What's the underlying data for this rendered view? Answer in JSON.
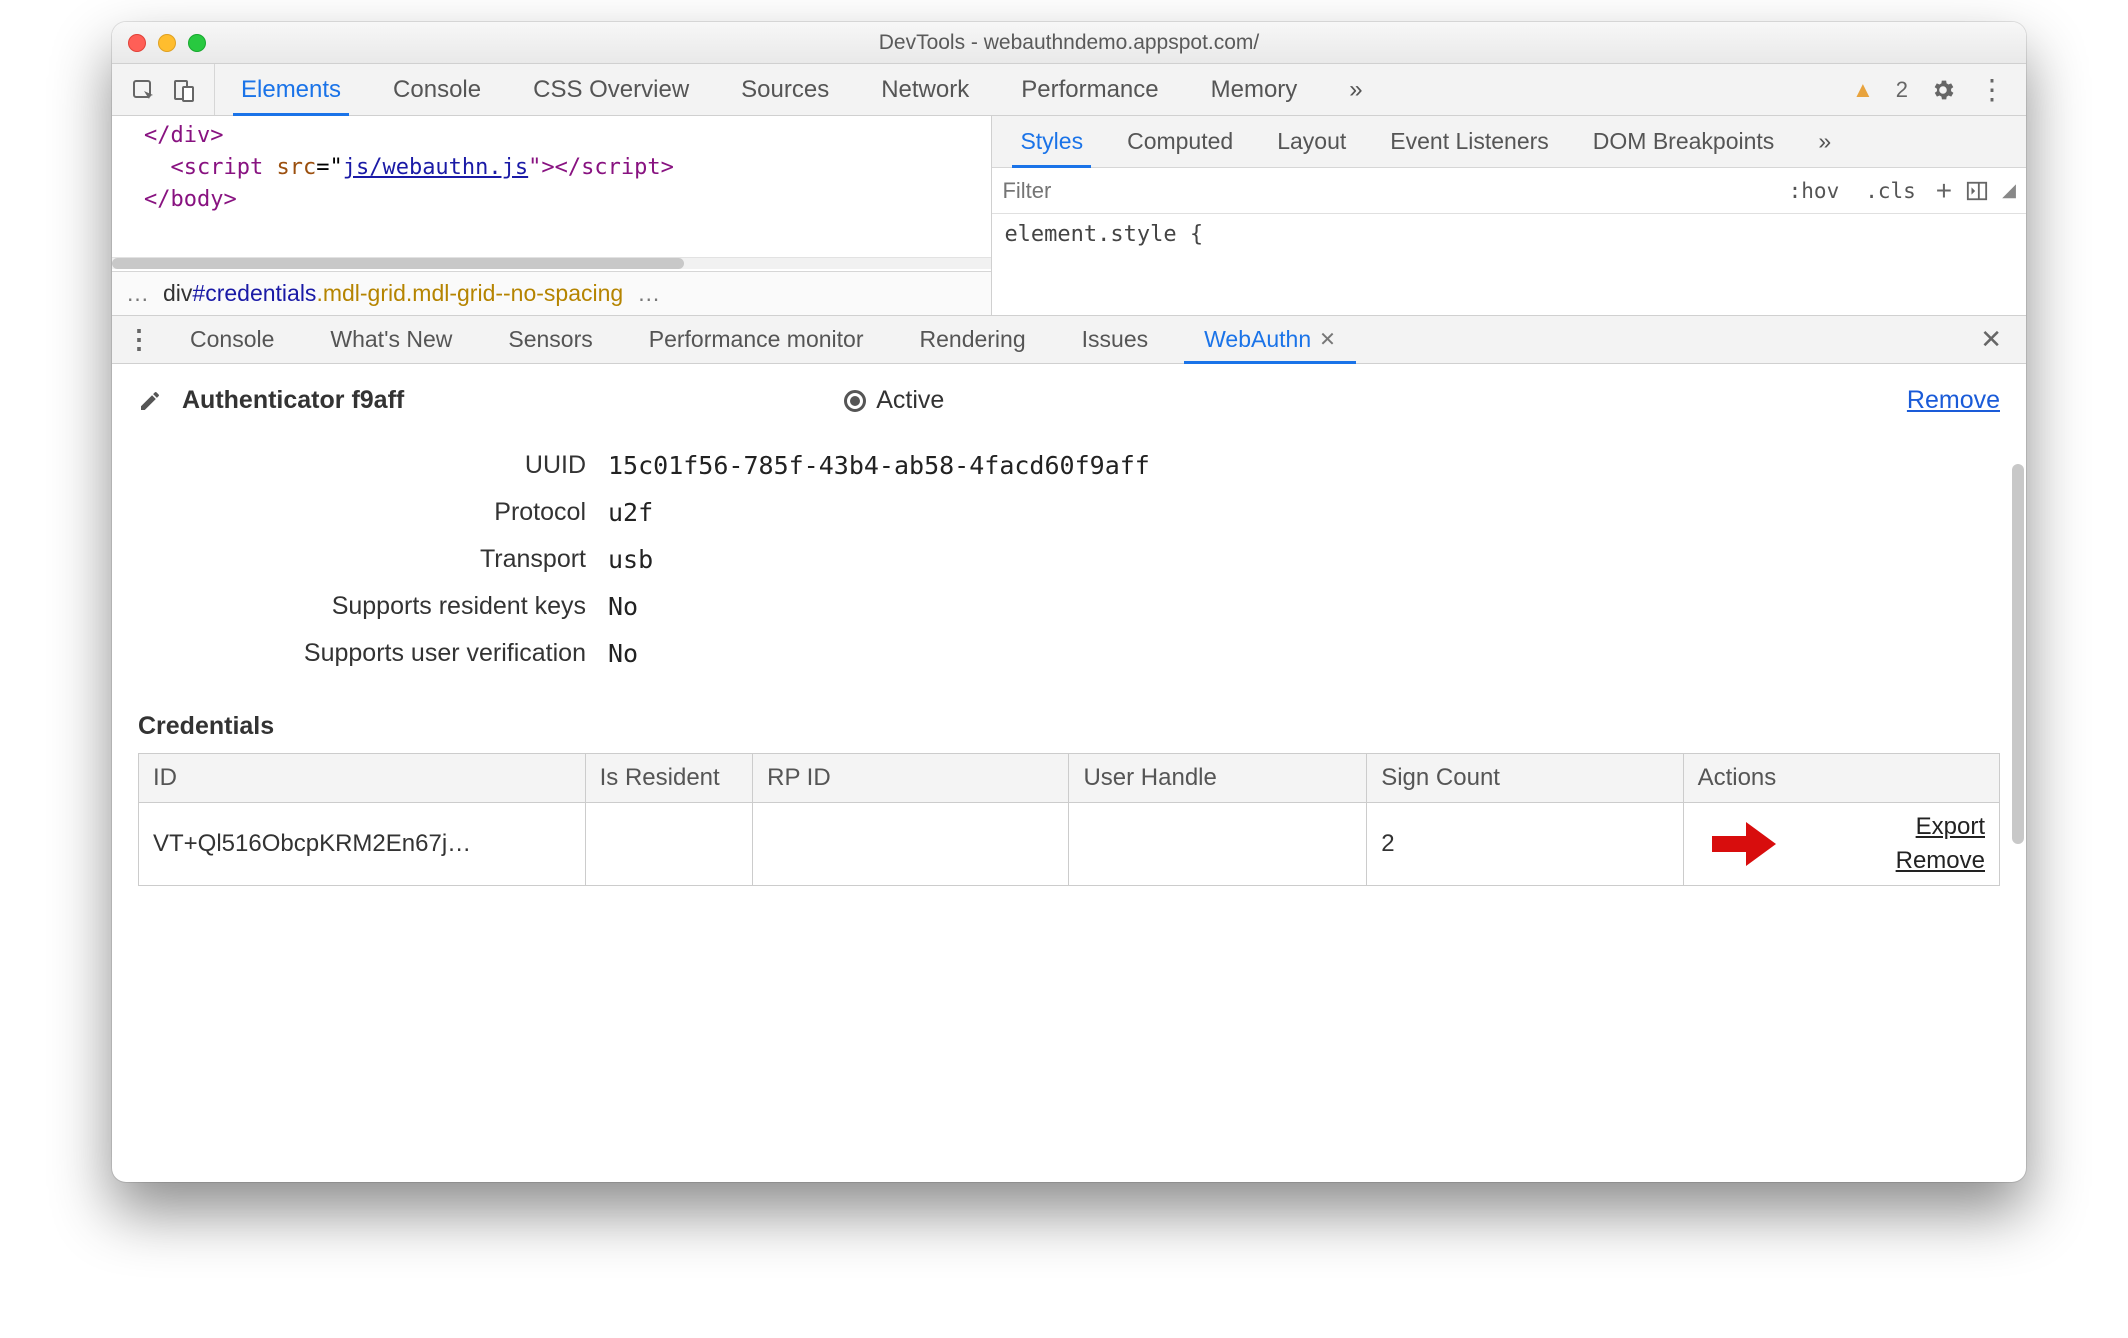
{
  "window": {
    "title": "DevTools - webauthndemo.appspot.com/"
  },
  "mainTabs": {
    "items": [
      "Elements",
      "Console",
      "CSS Overview",
      "Sources",
      "Network",
      "Performance",
      "Memory"
    ],
    "activeIndex": 0,
    "more": "»"
  },
  "warnings": {
    "count": "2"
  },
  "elementsCode": {
    "line1a": "</",
    "line1b": "div",
    "line1c": ">",
    "line2a": "<",
    "line2b": "script",
    "line2c": " src",
    "line2d": "=\"",
    "line2e": "js/webauthn.js",
    "line2f": "\"></",
    "line2g": "script",
    "line2h": ">",
    "line3a": "</",
    "line3b": "body",
    "line3c": ">"
  },
  "breadcrumb": {
    "pre": "…",
    "element": "div",
    "id": "#credentials",
    "classes": ".mdl-grid.mdl-grid--no-spacing",
    "post": "…"
  },
  "stylesTabs": {
    "items": [
      "Styles",
      "Computed",
      "Layout",
      "Event Listeners",
      "DOM Breakpoints"
    ],
    "activeIndex": 0,
    "more": "»"
  },
  "filter": {
    "placeholder": "Filter",
    "hov": ":hov",
    "cls": ".cls"
  },
  "styleBody": "element.style {",
  "drawerTabs": {
    "items": [
      "Console",
      "What's New",
      "Sensors",
      "Performance monitor",
      "Rendering",
      "Issues",
      "WebAuthn"
    ],
    "activeIndex": 6
  },
  "auth": {
    "name": "Authenticator f9aff",
    "active": "Active",
    "remove": "Remove",
    "uuidLabel": "UUID",
    "uuid": "15c01f56-785f-43b4-ab58-4facd60f9aff",
    "protocolLabel": "Protocol",
    "protocol": "u2f",
    "transportLabel": "Transport",
    "transport": "usb",
    "residentLabel": "Supports resident keys",
    "resident": "No",
    "verifyLabel": "Supports user verification",
    "verify": "No"
  },
  "credentials": {
    "heading": "Credentials",
    "cols": [
      "ID",
      "Is Resident",
      "RP ID",
      "User Handle",
      "Sign Count",
      "Actions"
    ],
    "row": {
      "id": "VT+Ql516ObcpKRM2En67j…",
      "isResident": "",
      "rpId": "",
      "userHandle": "",
      "signCount": "2",
      "export": "Export",
      "remove": "Remove"
    }
  }
}
